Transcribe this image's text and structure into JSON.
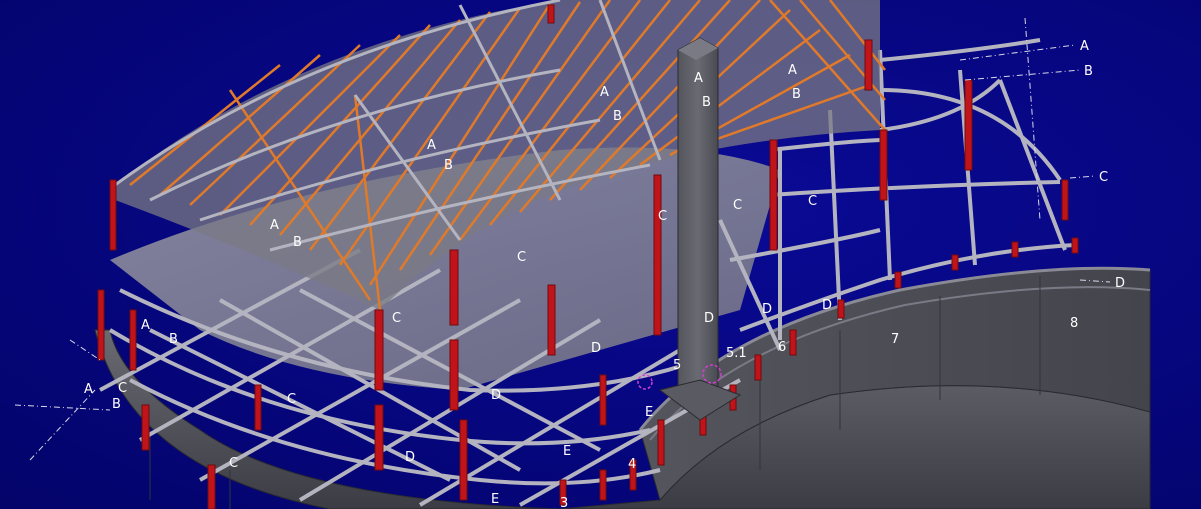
{
  "colors": {
    "background": "#05057a",
    "roof_rafter": "#e07a2a",
    "steel_beam": "#a9a9b3",
    "column": "#c0141a",
    "wall": "#4a4a52",
    "wall_dark": "#3a3a40",
    "core": "#5a5a62",
    "grid_line": "#d8d8e8",
    "highlight": "#d040d0"
  },
  "grid_labels": [
    {
      "id": "A-right",
      "text": "A"
    },
    {
      "id": "B-right",
      "text": "B"
    },
    {
      "id": "C-right",
      "text": "C"
    },
    {
      "id": "D-right",
      "text": "D"
    },
    {
      "id": "A-left",
      "text": "A"
    },
    {
      "id": "B-left",
      "text": "B"
    },
    {
      "id": "A-core",
      "text": "A"
    },
    {
      "id": "B-core",
      "text": "B"
    },
    {
      "id": "A-roof1",
      "text": "A"
    },
    {
      "id": "B-roof1",
      "text": "B"
    },
    {
      "id": "A-roof2",
      "text": "A"
    },
    {
      "id": "B-roof2",
      "text": "B"
    },
    {
      "id": "A-roof3",
      "text": "A"
    },
    {
      "id": "B-roof3",
      "text": "B"
    },
    {
      "id": "A-roof4",
      "text": "A"
    },
    {
      "id": "B-roof4",
      "text": "B"
    },
    {
      "id": "A-ring",
      "text": "A"
    },
    {
      "id": "B-ring",
      "text": "B"
    },
    {
      "id": "C-1",
      "text": "C"
    },
    {
      "id": "C-2",
      "text": "C"
    },
    {
      "id": "C-3",
      "text": "C"
    },
    {
      "id": "C-4",
      "text": "C"
    },
    {
      "id": "C-5",
      "text": "C"
    },
    {
      "id": "C-6",
      "text": "C"
    },
    {
      "id": "C-7",
      "text": "C"
    },
    {
      "id": "C-8",
      "text": "C"
    },
    {
      "id": "D-1",
      "text": "D"
    },
    {
      "id": "D-2",
      "text": "D"
    },
    {
      "id": "D-3",
      "text": "D"
    },
    {
      "id": "D-4",
      "text": "D"
    },
    {
      "id": "D-5",
      "text": "D"
    },
    {
      "id": "D-6",
      "text": "D"
    },
    {
      "id": "E-1",
      "text": "E"
    },
    {
      "id": "E-2",
      "text": "E"
    },
    {
      "id": "E-3",
      "text": "E"
    }
  ],
  "axis_numbers": [
    {
      "id": "n3",
      "text": "3"
    },
    {
      "id": "n4",
      "text": "4"
    },
    {
      "id": "n5",
      "text": "5"
    },
    {
      "id": "n5-1",
      "text": "5.1"
    },
    {
      "id": "n6",
      "text": "6"
    },
    {
      "id": "n7",
      "text": "7"
    },
    {
      "id": "n8",
      "text": "8"
    }
  ]
}
